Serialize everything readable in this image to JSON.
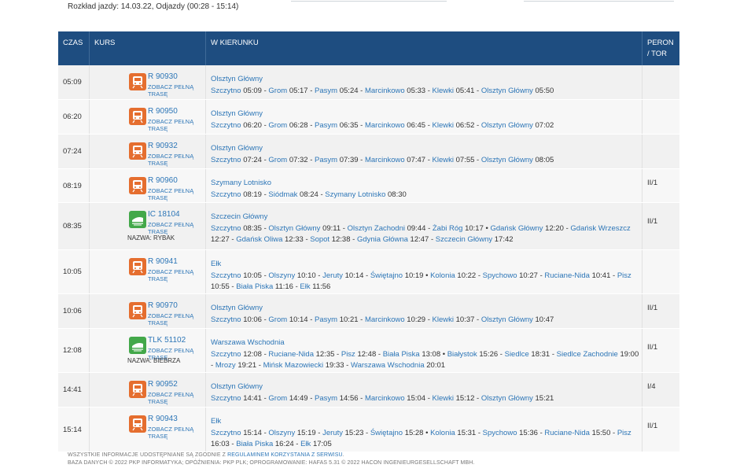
{
  "header": {
    "schedule_title": "Rozkład jazdy: 14.03.22, Odjazdy (00:28 - 15:14)"
  },
  "columns": {
    "time": "CZAS",
    "kurs": "KURS",
    "direction": "W KIERUNKU",
    "peron": "PERON / TOR"
  },
  "full_route_label": "ZOBACZ PEŁNĄ TRASĘ",
  "rows": [
    {
      "time": "05:09",
      "type": "R",
      "number": "R 90930",
      "name": "",
      "destination": "Olsztyn Główny",
      "peron": "",
      "stops": [
        {
          "station": "Szczytno",
          "time": "05:09",
          "sep": "-"
        },
        {
          "station": "Grom",
          "time": "05:17",
          "sep": "-"
        },
        {
          "station": "Pasym",
          "time": "05:24",
          "sep": "-"
        },
        {
          "station": "Marcinkowo",
          "time": "05:33",
          "sep": "-"
        },
        {
          "station": "Klewki",
          "time": "05:41",
          "sep": "-"
        },
        {
          "station": "Olsztyn Główny",
          "time": "05:50",
          "sep": ""
        }
      ]
    },
    {
      "time": "06:20",
      "type": "R",
      "number": "R 90950",
      "name": "",
      "destination": "Olsztyn Główny",
      "peron": "",
      "stops": [
        {
          "station": "Szczytno",
          "time": "06:20",
          "sep": "-"
        },
        {
          "station": "Grom",
          "time": "06:28",
          "sep": "-"
        },
        {
          "station": "Pasym",
          "time": "06:35",
          "sep": "-"
        },
        {
          "station": "Marcinkowo",
          "time": "06:45",
          "sep": "-"
        },
        {
          "station": "Klewki",
          "time": "06:52",
          "sep": "-"
        },
        {
          "station": "Olsztyn Główny",
          "time": "07:02",
          "sep": ""
        }
      ]
    },
    {
      "time": "07:24",
      "type": "R",
      "number": "R 90932",
      "name": "",
      "destination": "Olsztyn Główny",
      "peron": "",
      "stops": [
        {
          "station": "Szczytno",
          "time": "07:24",
          "sep": "-"
        },
        {
          "station": "Grom",
          "time": "07:32",
          "sep": "-"
        },
        {
          "station": "Pasym",
          "time": "07:39",
          "sep": "-"
        },
        {
          "station": "Marcinkowo",
          "time": "07:47",
          "sep": "-"
        },
        {
          "station": "Klewki",
          "time": "07:55",
          "sep": "-"
        },
        {
          "station": "Olsztyn Główny",
          "time": "08:05",
          "sep": ""
        }
      ]
    },
    {
      "time": "08:19",
      "type": "R",
      "number": "R 90960",
      "name": "",
      "destination": "Szymany Lotnisko",
      "peron": "II/1",
      "stops": [
        {
          "station": "Szczytno",
          "time": "08:19",
          "sep": "-"
        },
        {
          "station": "Siódmak",
          "time": "08:24",
          "sep": "-"
        },
        {
          "station": "Szymany Lotnisko",
          "time": "08:30",
          "sep": ""
        }
      ]
    },
    {
      "time": "08:35",
      "type": "IC",
      "number": "IC 18104",
      "name_label": "NAZWA:",
      "name": "RYBAK",
      "destination": "Szczecin Główny",
      "peron": "II/1",
      "stops": [
        {
          "station": "Szczytno",
          "time": "08:35",
          "sep": "-"
        },
        {
          "station": "Olsztyn Główny",
          "time": "09:11",
          "sep": "-"
        },
        {
          "station": "Olsztyn Zachodni",
          "time": "09:44",
          "sep": "-"
        },
        {
          "station": "Żabi Róg",
          "time": "10:17",
          "sep": "•"
        },
        {
          "station": "Gdańsk Główny",
          "time": "12:20",
          "sep": "-"
        },
        {
          "station": "Gdańsk Wrzeszcz",
          "time": "12:27",
          "sep": "-"
        },
        {
          "station": "Gdańsk Oliwa",
          "time": "12:33",
          "sep": "-"
        },
        {
          "station": "Sopot",
          "time": "12:38",
          "sep": "-"
        },
        {
          "station": "Gdynia Główna",
          "time": "12:47",
          "sep": "-"
        },
        {
          "station": "Szczecin Główny",
          "time": "17:42",
          "sep": ""
        }
      ]
    },
    {
      "time": "10:05",
      "type": "R",
      "number": "R 90941",
      "name": "",
      "destination": "Ełk",
      "peron": "",
      "stops": [
        {
          "station": "Szczytno",
          "time": "10:05",
          "sep": "-"
        },
        {
          "station": "Olszyny",
          "time": "10:10",
          "sep": "-"
        },
        {
          "station": "Jeruty",
          "time": "10:14",
          "sep": "-"
        },
        {
          "station": "Świętajno",
          "time": "10:19",
          "sep": "•"
        },
        {
          "station": "Kolonia",
          "time": "10:22",
          "sep": "-"
        },
        {
          "station": "Spychowo",
          "time": "10:27",
          "sep": "-"
        },
        {
          "station": "Ruciane-Nida",
          "time": "10:41",
          "sep": "-"
        },
        {
          "station": "Pisz",
          "time": "10:55",
          "sep": "-"
        },
        {
          "station": "Biała Piska",
          "time": "11:16",
          "sep": "-"
        },
        {
          "station": "Ełk",
          "time": "11:56",
          "sep": ""
        }
      ]
    },
    {
      "time": "10:06",
      "type": "R",
      "number": "R 90970",
      "name": "",
      "destination": "Olsztyn Główny",
      "peron": "II/1",
      "stops": [
        {
          "station": "Szczytno",
          "time": "10:06",
          "sep": "-"
        },
        {
          "station": "Grom",
          "time": "10:14",
          "sep": "-"
        },
        {
          "station": "Pasym",
          "time": "10:21",
          "sep": "-"
        },
        {
          "station": "Marcinkowo",
          "time": "10:29",
          "sep": "-"
        },
        {
          "station": "Klewki",
          "time": "10:37",
          "sep": "-"
        },
        {
          "station": "Olsztyn Główny",
          "time": "10:47",
          "sep": ""
        }
      ]
    },
    {
      "time": "12:08",
      "type": "TLK",
      "number": "TLK 51102",
      "name_label": "NAZWA:",
      "name": "BIEBRZA",
      "destination": "Warszawa Wschodnia",
      "peron": "II/1",
      "stops": [
        {
          "station": "Szczytno",
          "time": "12:08",
          "sep": "-"
        },
        {
          "station": "Ruciane-Nida",
          "time": "12:35",
          "sep": "-"
        },
        {
          "station": "Pisz",
          "time": "12:48",
          "sep": "-"
        },
        {
          "station": "Biała Piska",
          "time": "13:08",
          "sep": "•"
        },
        {
          "station": "Białystok",
          "time": "15:26",
          "sep": "-"
        },
        {
          "station": "Siedlce",
          "time": "18:31",
          "sep": "-"
        },
        {
          "station": "Siedlce Zachodnie",
          "time": "19:00",
          "sep": "-"
        },
        {
          "station": "Mrozy",
          "time": "19:21",
          "sep": "-"
        },
        {
          "station": "Mińsk Mazowiecki",
          "time": "19:33",
          "sep": "-"
        },
        {
          "station": "Warszawa Wschodnia",
          "time": "20:01",
          "sep": ""
        }
      ]
    },
    {
      "time": "14:41",
      "type": "R",
      "number": "R 90952",
      "name": "",
      "destination": "Olsztyn Główny",
      "peron": "I/4",
      "stops": [
        {
          "station": "Szczytno",
          "time": "14:41",
          "sep": "-"
        },
        {
          "station": "Grom",
          "time": "14:49",
          "sep": "-"
        },
        {
          "station": "Pasym",
          "time": "14:56",
          "sep": "-"
        },
        {
          "station": "Marcinkowo",
          "time": "15:04",
          "sep": "-"
        },
        {
          "station": "Klewki",
          "time": "15:12",
          "sep": "-"
        },
        {
          "station": "Olsztyn Główny",
          "time": "15:21",
          "sep": ""
        }
      ]
    },
    {
      "time": "15:14",
      "type": "R",
      "number": "R 90943",
      "name": "",
      "destination": "Ełk",
      "peron": "II/1",
      "stops": [
        {
          "station": "Szczytno",
          "time": "15:14",
          "sep": "-"
        },
        {
          "station": "Olszyny",
          "time": "15:19",
          "sep": "-"
        },
        {
          "station": "Jeruty",
          "time": "15:23",
          "sep": "-"
        },
        {
          "station": "Świętajno",
          "time": "15:28",
          "sep": "•"
        },
        {
          "station": "Kolonia",
          "time": "15:31",
          "sep": "-"
        },
        {
          "station": "Spychowo",
          "time": "15:36",
          "sep": "-"
        },
        {
          "station": "Ruciane-Nida",
          "time": "15:50",
          "sep": "-"
        },
        {
          "station": "Pisz",
          "time": "16:03",
          "sep": "-"
        },
        {
          "station": "Biała Piska",
          "time": "16:24",
          "sep": "-"
        },
        {
          "station": "Ełk",
          "time": "17:05",
          "sep": ""
        }
      ]
    }
  ],
  "footer": {
    "line1_prefix": "WSZYSTKIE INFORMACJE UDOSTĘPNIANE SĄ ZGODNIE Z ",
    "line1_link": "REGULAMINEM KORZYSTANIA Z SERWISU",
    "line1_suffix": ".",
    "line2": "BAZA DANYCH © 2022 PKP INFORMATYKA; OPÓŹNIENIA: PKP PLK; OPROGRAMOWANIE: HAFAS 5.31 © 2022 HACON INGENIEURGESELLSCHAFT MBH."
  },
  "colors": {
    "header_bg": "#1e4d80",
    "link": "#2d76b7",
    "regio_icon": "#e56e2f",
    "ic_icon": "#43a84a"
  },
  "icons": {
    "R": "regio-train-icon",
    "IC": "intercity-train-icon",
    "TLK": "tlk-train-icon"
  }
}
